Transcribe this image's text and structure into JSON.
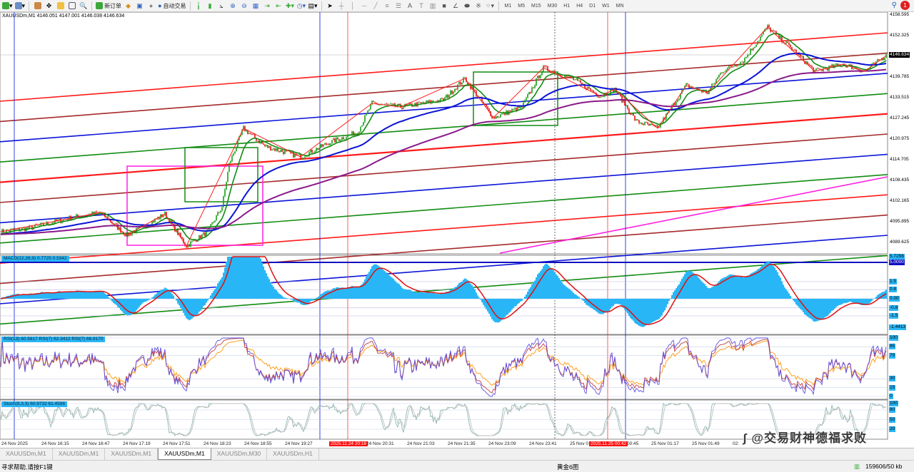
{
  "toolbar": {
    "new_order": "新订单",
    "auto_trading": "自动交易",
    "timeframes": [
      "M1",
      "M5",
      "M15",
      "M30",
      "H1",
      "H4",
      "D1",
      "W1",
      "MN"
    ],
    "alert_count": "1"
  },
  "chart": {
    "header": "XAUUSDm,M1  4146.051 4147.001 4146.038 4146.634",
    "current_price": "4146.634",
    "price_axis": [
      "4158.595",
      "4152.325",
      "4146.634",
      "4139.785",
      "4133.515",
      "4127.245",
      "4120.975",
      "4114.705",
      "4108.435",
      "4102.165",
      "4095.895",
      "4089.625"
    ],
    "price_ticks": [
      4158.595,
      4152.325,
      4139.785,
      4133.515,
      4127.245,
      4120.975,
      4114.705,
      4108.435,
      4102.165,
      4095.895,
      4089.625
    ],
    "price_range": [
      4089.625,
      4158.595
    ],
    "time_axis": [
      "24 Nov 2025",
      "24 Nov 16:15",
      "24 Nov 16:47",
      "24 Nov 17:19",
      "24 Nov 17:51",
      "24 Nov 18:23",
      "24 Nov 18:55",
      "24 Nov 19:27",
      "2025.11.24 20:16",
      "24 Nov 20:31",
      "24 Nov 21:03",
      "24 Nov 21:35",
      "24 Nov 23:09",
      "24 Nov 23:41",
      "25 Nov 0",
      "2025.11.25 00:42",
      "00:45",
      "25 Nov 01:17",
      "25 Nov 01:49",
      "02:"
    ],
    "price_path": [
      [
        0,
        4092.87
      ],
      [
        20,
        4093.95
      ],
      [
        40,
        4096.11
      ],
      [
        50,
        4097.19
      ],
      [
        70,
        4098.71
      ],
      [
        88,
        4091.79
      ],
      [
        100,
        4094.38
      ],
      [
        115,
        4098.27
      ],
      [
        130,
        4088.54
      ],
      [
        145,
        4092.9
      ],
      [
        155,
        4100.43
      ],
      [
        160,
        4113.41
      ],
      [
        170,
        4124.22
      ],
      [
        185,
        4118.81
      ],
      [
        210,
        4115.57
      ],
      [
        230,
        4119.87
      ],
      [
        250,
        4123.14
      ],
      [
        260,
        4131.79
      ],
      [
        280,
        4130.71
      ],
      [
        310,
        4132.87
      ],
      [
        325,
        4139.35
      ],
      [
        345,
        4127.46
      ],
      [
        365,
        4130.71
      ],
      [
        380,
        4142.6
      ],
      [
        400,
        4139.35
      ],
      [
        420,
        4133.95
      ],
      [
        430,
        4136.11
      ],
      [
        445,
        4126.38
      ],
      [
        460,
        4124.22
      ],
      [
        470,
        4130.71
      ],
      [
        480,
        4137.19
      ],
      [
        495,
        4135.03
      ],
      [
        505,
        4141.51
      ],
      [
        520,
        4144.76
      ],
      [
        537,
        4154.92
      ],
      [
        555,
        4148.0
      ],
      [
        570,
        4141.51
      ],
      [
        590,
        4143.68
      ],
      [
        605,
        4141.51
      ],
      [
        620,
        4146.27
      ]
    ],
    "colors": {
      "red": "#ff1a1a",
      "brown": "#a52a2a",
      "blue": "#0a14d8",
      "green": "#128c12",
      "magenta": "#ff20e0",
      "purple": "#8a1a8a"
    }
  },
  "macd": {
    "label": "MACD(12,26,9) 0.7725 0.5342",
    "axis": [
      "5.7256",
      "5.0000",
      "1.5",
      "0.8",
      "0.00",
      "-0.8",
      "-1.5",
      "-1.4413"
    ],
    "levels": [
      1.5,
      0.8,
      0,
      -0.8,
      -1.5
    ]
  },
  "rsi": {
    "label": "RSI(13) 60.5817  RSI(7) 62.3412  RSI(7) 66.9170",
    "axis": [
      "100",
      "85",
      "70",
      "30",
      "15",
      "0"
    ],
    "levels": [
      100,
      85,
      70,
      30,
      15,
      0
    ]
  },
  "stoch": {
    "label": "Stoch(9,3,3) 60.9732 61.4598",
    "axis": [
      "100",
      "80",
      "50",
      "20"
    ],
    "levels": [
      100,
      80,
      50,
      20
    ]
  },
  "tabs": [
    "XAUUSDm,M1",
    "XAUUSDm,M1",
    "XAUUSDm,M1",
    "XAUUSDm,M1",
    "XAUUSDm,M30",
    "XAUUSDm,H1"
  ],
  "active_tab": 3,
  "status": {
    "help": "寻求帮助,请按F1键",
    "profile": "黄金6图",
    "traffic": "159606/50 kb"
  },
  "watermark": "@交易财神德福求败"
}
